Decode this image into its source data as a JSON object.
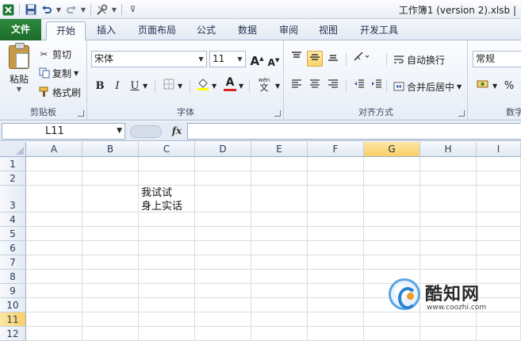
{
  "window": {
    "title": "工作簿1 (version 2).xlsb |"
  },
  "ribbon_tabs": [
    "文件",
    "开始",
    "插入",
    "页面布局",
    "公式",
    "数据",
    "审阅",
    "视图",
    "开发工具"
  ],
  "clipboard": {
    "paste": "粘贴",
    "cut": "剪切",
    "copy": "复制",
    "format_painter": "格式刷",
    "group_label": "剪贴板"
  },
  "font": {
    "name": "宋体",
    "size": "11",
    "grow_glyph": "A",
    "shrink_glyph": "A",
    "bold": "B",
    "italic": "I",
    "underline": "U",
    "font_color_glyph": "A",
    "phonetic_glyph": "wén",
    "group_label": "字体"
  },
  "alignment": {
    "wrap_text": "自动换行",
    "merge_center": "合并后居中",
    "group_label": "对齐方式"
  },
  "number": {
    "format": "常规",
    "percent": "%",
    "group_label": "数字"
  },
  "formula_bar": {
    "name_box": "L11",
    "fx": "fx",
    "content": ""
  },
  "sheet": {
    "columns": [
      "A",
      "B",
      "C",
      "D",
      "E",
      "F",
      "G",
      "H",
      "I"
    ],
    "rows": [
      "1",
      "2",
      "3",
      "4",
      "5",
      "6",
      "7",
      "8",
      "9",
      "10",
      "11",
      "12"
    ],
    "selected_column": "G",
    "selected_row": "11",
    "cells": {
      "C3": "我试试\n身上实话"
    }
  },
  "watermark": {
    "name": "酷知网",
    "url": "www.coozhi.com"
  },
  "colors": {
    "file_tab": "#1d6b2a",
    "selection": "#f9cf68",
    "accent": "#2d82cf"
  }
}
